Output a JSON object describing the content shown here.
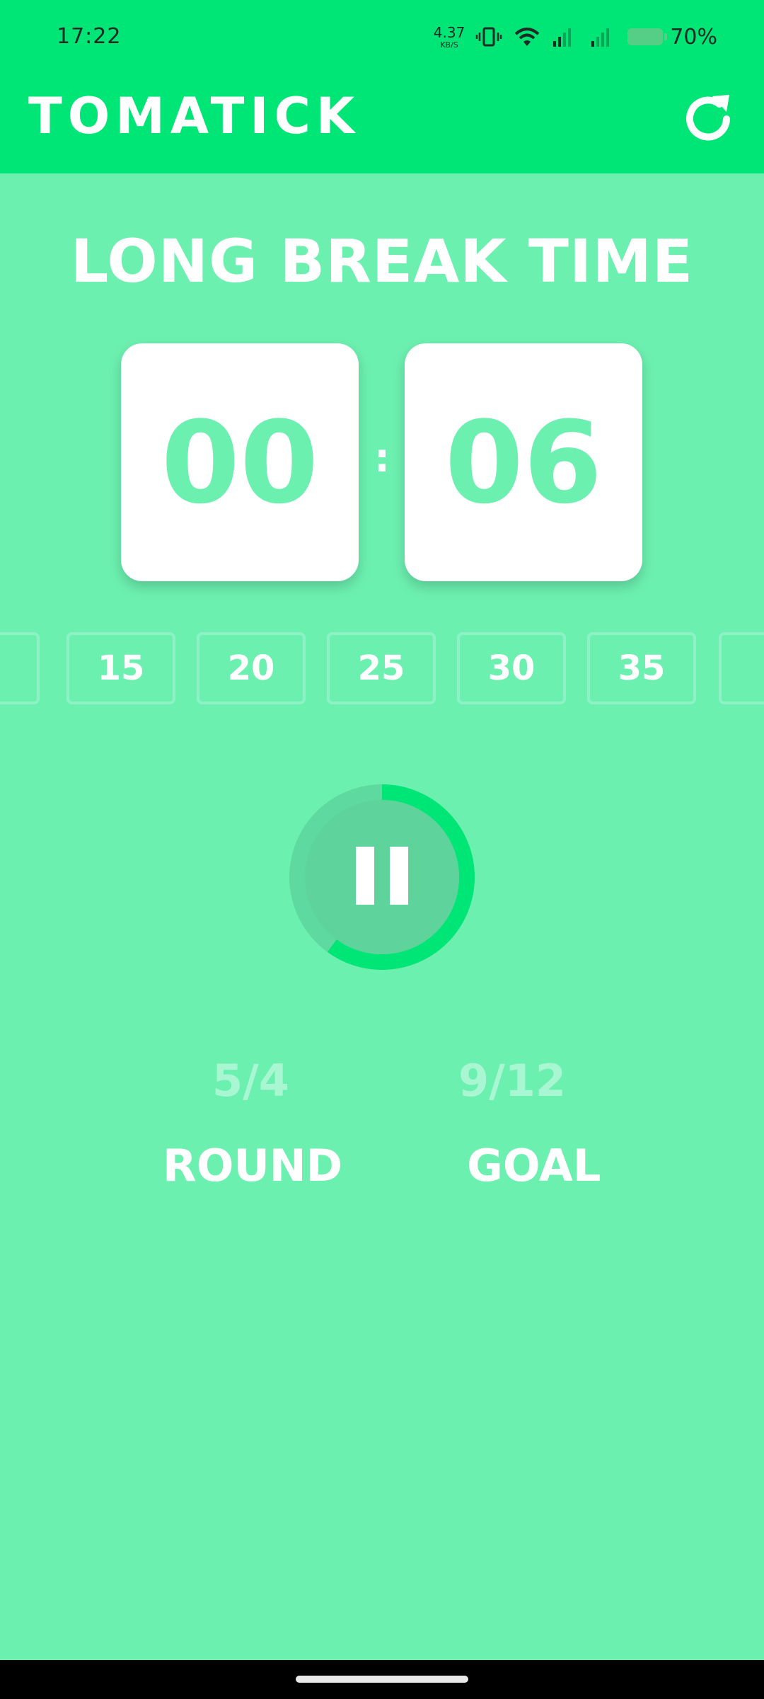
{
  "status_bar": {
    "time": "17:22",
    "net_speed_value": "4.37",
    "net_speed_unit": "KB/S",
    "battery_percent": "70%"
  },
  "app_bar": {
    "title": "TOMATICK",
    "refresh_icon": "refresh-icon"
  },
  "timer": {
    "phase": "LONG BREAK TIME",
    "minutes": "00",
    "separator": ":",
    "seconds": "06",
    "progress_fraction": 0.6
  },
  "presets": [
    "15",
    "20",
    "25",
    "30",
    "35"
  ],
  "controls": {
    "play_pause_icon": "pause-icon"
  },
  "stats": {
    "round_value": "5/4",
    "round_label": "ROUND",
    "goal_value": "9/12",
    "goal_label": "GOAL"
  },
  "colors": {
    "primary": "#00E676",
    "background": "#6CF0B0",
    "card": "#FFFFFF",
    "digits": "#6CF0B0"
  }
}
